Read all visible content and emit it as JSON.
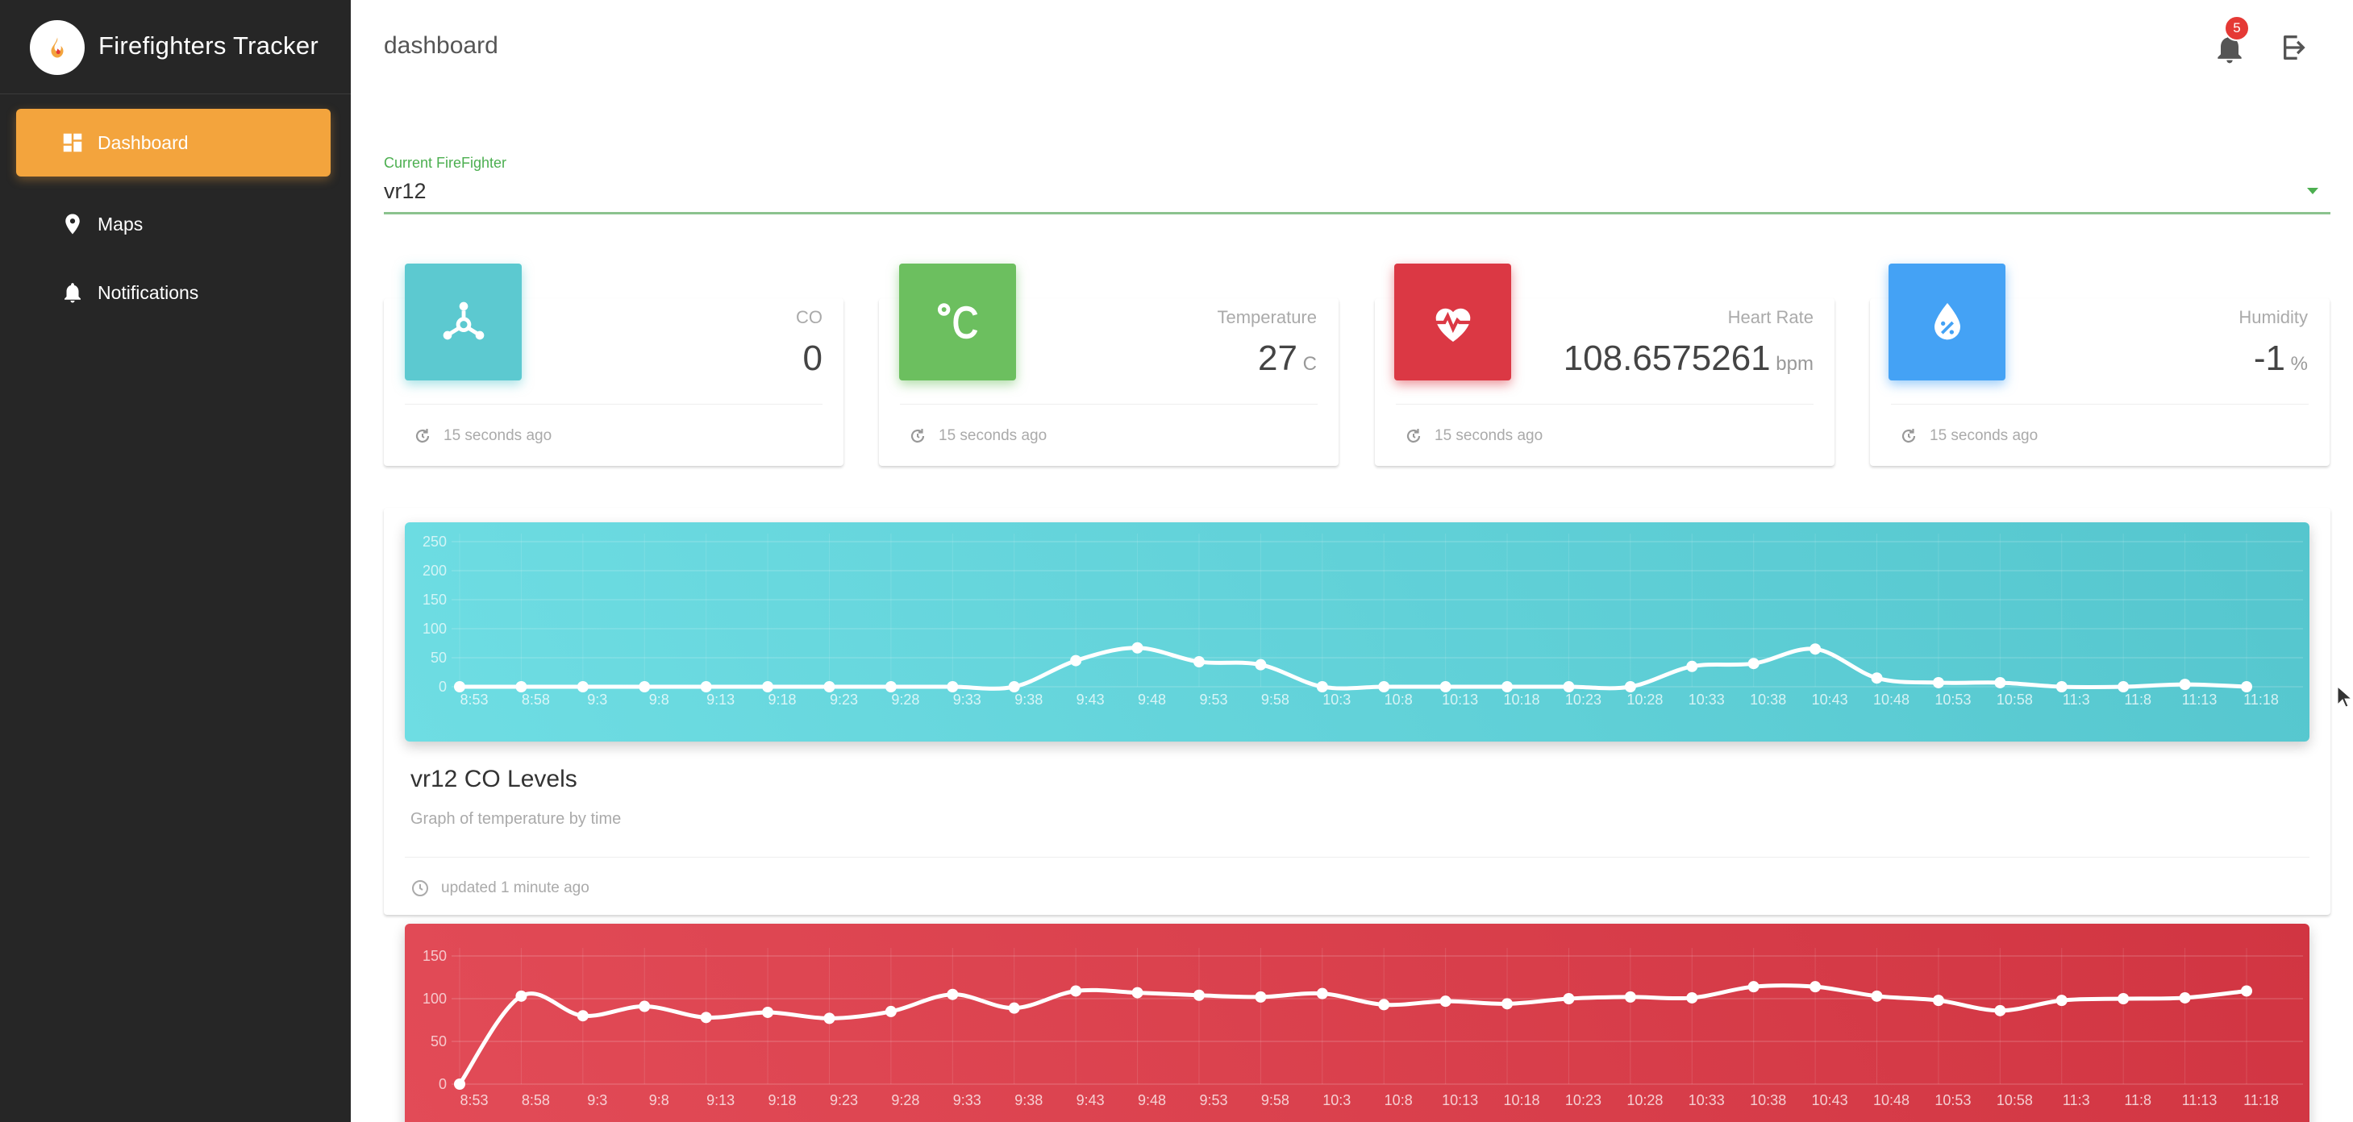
{
  "sidebar": {
    "brand": {
      "title": "Firefighters Tracker",
      "logo_icon": "flame-icon"
    },
    "items": [
      {
        "label": "Dashboard",
        "icon": "dashboard-icon",
        "active": true
      },
      {
        "label": "Maps",
        "icon": "map-pin-icon",
        "active": false
      },
      {
        "label": "Notifications",
        "icon": "bell-icon",
        "active": false
      }
    ]
  },
  "header": {
    "title": "dashboard",
    "notification_count": "5"
  },
  "selector": {
    "label": "Current FireFighter",
    "value": "vr12"
  },
  "stats": [
    {
      "label": "CO",
      "value": "0",
      "unit": "",
      "footer": "15 seconds ago",
      "color": "#5cc9d0",
      "icon": "molecule-icon"
    },
    {
      "label": "Temperature",
      "value": "27",
      "unit": "C",
      "footer": "15 seconds ago",
      "color": "#6cbf5f",
      "icon": "celsius-icon"
    },
    {
      "label": "Heart Rate",
      "value": "108.6575261",
      "unit": "bpm",
      "footer": "15 seconds ago",
      "color": "#db3844",
      "icon": "heart-pulse-icon"
    },
    {
      "label": "Humidity",
      "value": "-1",
      "unit": "%",
      "footer": "15 seconds ago",
      "color": "#44a2f5",
      "icon": "humidity-icon"
    }
  ],
  "co_card": {
    "title": "vr12 CO Levels",
    "subtitle": "Graph of temperature by time",
    "footer": "updated 1 minute ago"
  },
  "chart_data": [
    {
      "type": "line",
      "title": "vr12 CO Levels",
      "categories": [
        "8:53",
        "8:58",
        "9:3",
        "9:8",
        "9:13",
        "9:18",
        "9:23",
        "9:28",
        "9:33",
        "9:38",
        "9:43",
        "9:48",
        "9:53",
        "9:58",
        "10:3",
        "10:8",
        "10:13",
        "10:18",
        "10:23",
        "10:28",
        "10:33",
        "10:38",
        "10:43",
        "10:48",
        "10:53",
        "10:58",
        "11:3",
        "11:8",
        "11:13",
        "11:18"
      ],
      "values": [
        0,
        0,
        0,
        0,
        0,
        0,
        0,
        0,
        0,
        0,
        45,
        67,
        43,
        38,
        0,
        0,
        0,
        0,
        0,
        0,
        35,
        40,
        65,
        15,
        7,
        7,
        0,
        0,
        4,
        0
      ],
      "yticks": [
        0,
        50,
        100,
        150,
        200,
        250
      ],
      "ylim": [
        0,
        250
      ],
      "grid": true
    },
    {
      "type": "line",
      "title": "",
      "categories": [
        "8:53",
        "8:58",
        "9:3",
        "9:8",
        "9:13",
        "9:18",
        "9:23",
        "9:28",
        "9:33",
        "9:38",
        "9:43",
        "9:48",
        "9:53",
        "9:58",
        "10:3",
        "10:8",
        "10:13",
        "10:18",
        "10:23",
        "10:28",
        "10:33",
        "10:38",
        "10:43",
        "10:48",
        "10:53",
        "10:58",
        "11:3",
        "11:8",
        "11:13",
        "11:18"
      ],
      "values": [
        0,
        103,
        80,
        91,
        78,
        84,
        77,
        85,
        105,
        89,
        109,
        107,
        104,
        102,
        106,
        93,
        97,
        94,
        100,
        102,
        101,
        114,
        114,
        103,
        98,
        86,
        98,
        100,
        101,
        109
      ],
      "yticks": [
        0,
        50,
        100,
        150
      ],
      "ylim": [
        0,
        150
      ],
      "grid": true
    }
  ]
}
